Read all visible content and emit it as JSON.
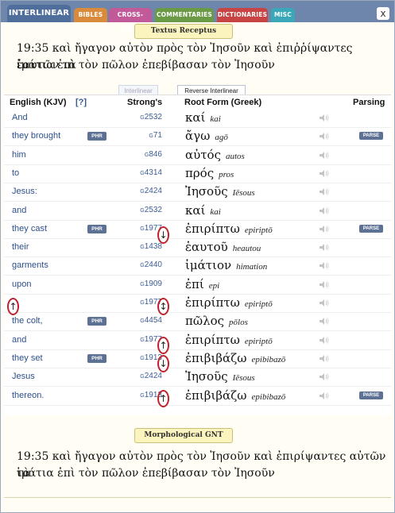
{
  "tabs": [
    {
      "label": "INTERLINEAR",
      "color": "#4f6e9c",
      "active": true
    },
    {
      "label": "BIBLES",
      "color": "#d98a3a"
    },
    {
      "label": "CROSS-REFS",
      "color": "#c25a9a"
    },
    {
      "label": "COMMENTARIES",
      "color": "#6a9a45"
    },
    {
      "label": "DICTIONARIES",
      "color": "#c84444"
    },
    {
      "label": "MISC",
      "color": "#3aa8b8"
    }
  ],
  "close_label": "x",
  "top_section": {
    "title": "Textus Receptus",
    "verse_line1": "19:35  καὶ ἤγαγον αὐτὸν πρὸς τὸν Ἰησοῦν καὶ ἐπιῤῥίψαντες ἑαυτῶν τὰ",
    "verse_line2": "ἱμάτια ἐπὶ τὸν πῶλον ἐπεβίβασαν τὸν Ἰησοῦν"
  },
  "interlinear_tabs": {
    "inactive": "Interlinear",
    "active": "Reverse Interlinear"
  },
  "headers": {
    "english": "English (KJV)",
    "help": "[?]",
    "strongs": "Strong's",
    "root": "Root Form (Greek)",
    "parsing": "Parsing"
  },
  "badges": {
    "phr": "PHR",
    "parse": "PARSE"
  },
  "rows": [
    {
      "english": "And",
      "phr": false,
      "g": "G",
      "num": "2532",
      "greek": "καί",
      "translit": "kai",
      "parse": false
    },
    {
      "english": "they brought",
      "phr": true,
      "g": "G",
      "num": "71",
      "greek": "ἄγω",
      "translit": "agō",
      "parse": true
    },
    {
      "english": "him",
      "phr": false,
      "g": "G",
      "num": "846",
      "greek": "αὐτός",
      "translit": "autos",
      "parse": false
    },
    {
      "english": "to",
      "phr": false,
      "g": "G",
      "num": "4314",
      "greek": "πρός",
      "translit": "pros",
      "parse": false
    },
    {
      "english": "Jesus:",
      "phr": false,
      "g": "G",
      "num": "2424",
      "greek": "Ἰησοῦς",
      "translit": "Iēsous",
      "parse": false
    },
    {
      "english": "and",
      "phr": false,
      "g": "G",
      "num": "2532",
      "greek": "καί",
      "translit": "kai",
      "parse": false
    },
    {
      "english": "they cast",
      "phr": true,
      "g": "G",
      "num": "1977",
      "greek": "ἐπιρίπτω",
      "translit": "epiriptō",
      "parse": true
    },
    {
      "english": "their",
      "phr": false,
      "g": "G",
      "num": "1438",
      "greek": "ἑαυτοῦ",
      "translit": "heautou",
      "parse": false
    },
    {
      "english": "garments",
      "phr": false,
      "g": "G",
      "num": "2440",
      "greek": "ἱμάτιον",
      "translit": "himation",
      "parse": false
    },
    {
      "english": "upon",
      "phr": false,
      "g": "G",
      "num": "1909",
      "greek": "ἐπί",
      "translit": "epi",
      "parse": false
    },
    {
      "english": "",
      "phr": false,
      "g": "G",
      "num": "1977",
      "greek": "ἐπιρίπτω",
      "translit": "epiriptō",
      "parse": false
    },
    {
      "english": "the colt,",
      "phr": true,
      "g": "G",
      "num": "4454",
      "greek": "πῶλος",
      "translit": "pōlos",
      "parse": false
    },
    {
      "english": "and",
      "phr": false,
      "g": "G",
      "num": "1977",
      "greek": "ἐπιρίπτω",
      "translit": "epiriptō",
      "parse": false
    },
    {
      "english": "they set",
      "phr": true,
      "g": "G",
      "num": "1913",
      "greek": "ἐπιβιβάζω",
      "translit": "epibibazō",
      "parse": false
    },
    {
      "english": "Jesus",
      "phr": false,
      "g": "G",
      "num": "2424",
      "greek": "Ἰησοῦς",
      "translit": "Iēsous",
      "parse": false
    },
    {
      "english": "thereon.",
      "phr": false,
      "g": "G",
      "num": "1913",
      "greek": "ἐπιβιβάζω",
      "translit": "epibibazō",
      "parse": true
    }
  ],
  "arrows": {
    "up": "↑",
    "down": "↓",
    "updown": "↕"
  },
  "bottom_section": {
    "title": "Morphological GNT",
    "verse_line1": "19:35  καὶ ἤγαγον αὐτὸν πρὸς τὸν Ἰησοῦν καὶ ἐπιρίψαντες αὐτῶν τὰ",
    "verse_line2": "ἱμάτια ἐπὶ τὸν πῶλον ἐπεβίβασαν τὸν Ἰησοῦν"
  },
  "speaker_icon": "speaker-icon"
}
